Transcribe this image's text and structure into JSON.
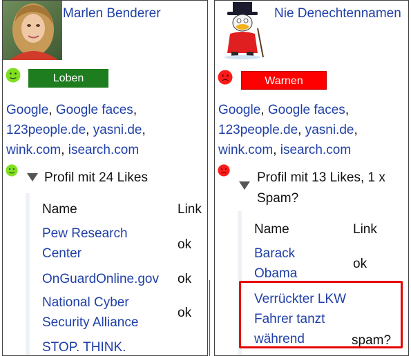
{
  "profiles": [
    {
      "name": "Marlen Benderer",
      "mood": "happy",
      "mood_color": "#7fe020",
      "action_label": "Loben",
      "action_color": "#1e7d1e",
      "search_links": [
        "Google",
        "Google faces",
        "123people.de",
        "yasni.de",
        "wink.com",
        "isearch.com"
      ],
      "likes_title": "Profil mit 24 Likes",
      "table_headers": {
        "name": "Name",
        "link": "Link"
      },
      "rows": [
        {
          "name": "Pew Research Center",
          "status": "ok"
        },
        {
          "name": "OnGuardOnline.gov",
          "status": "ok"
        },
        {
          "name": "National Cyber Security Alliance",
          "status": "ok"
        },
        {
          "name": "STOP. THINK.",
          "status": ""
        }
      ]
    },
    {
      "name": "Nie Denechtennamen",
      "mood": "sad",
      "mood_color": "#ff1a1a",
      "action_label": "Warnen",
      "action_color": "#ff0000",
      "search_links": [
        "Google",
        "Google faces",
        "123people.de",
        "yasni.de",
        "wink.com",
        "isearch.com"
      ],
      "likes_title": "Profil mit 13 Likes, 1 x Spam?",
      "table_headers": {
        "name": "Name",
        "link": "Link"
      },
      "rows": [
        {
          "name": "Barack Obama",
          "status": "ok"
        },
        {
          "name": "Verrückter LKW Fahrer tanzt während",
          "status": "spam?"
        }
      ]
    }
  ],
  "highlight_color": "#e60000",
  "icons": {
    "happy": "smiley-happy-icon",
    "sad": "smiley-sad-icon",
    "expand": "triangle-down-icon"
  }
}
